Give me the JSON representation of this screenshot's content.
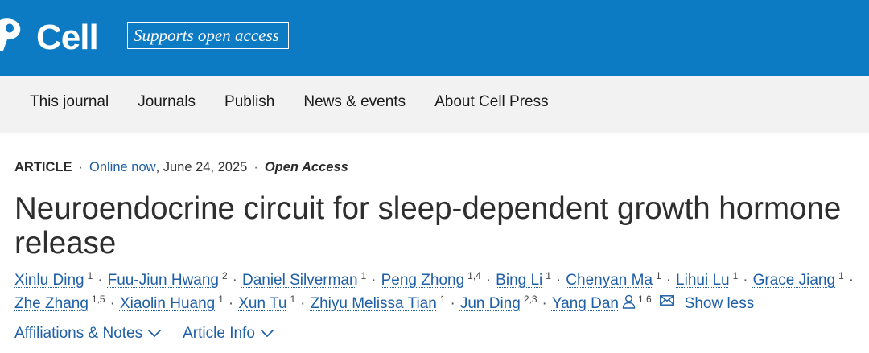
{
  "header": {
    "brand": "Cell",
    "tagline": "Supports open access",
    "logo_icon": "cell-press-logo-icon",
    "background_color": "#0d7bc4",
    "text_color": "#ffffff"
  },
  "nav": {
    "background_color": "#f2f2f2",
    "items": [
      {
        "label": "This journal"
      },
      {
        "label": "Journals"
      },
      {
        "label": "Publish"
      },
      {
        "label": "News & events"
      },
      {
        "label": "About Cell Press"
      }
    ]
  },
  "article": {
    "type_label": "ARTICLE",
    "separator": "·",
    "status": "Online now",
    "date_prefix": ",",
    "date": "June 24, 2025",
    "access": "Open Access",
    "title": "Neuroendocrine circuit for sleep-dependent growth hormone release",
    "link_color": "#1f5fa6",
    "authors": [
      {
        "name": "Xinlu Ding",
        "affiliations": "1"
      },
      {
        "name": "Fuu-Jiun Hwang",
        "affiliations": "2"
      },
      {
        "name": "Daniel Silverman",
        "affiliations": "1"
      },
      {
        "name": "Peng Zhong",
        "affiliations": "1,4"
      },
      {
        "name": "Bing Li",
        "affiliations": "1"
      },
      {
        "name": "Chenyan Ma",
        "affiliations": "1"
      },
      {
        "name": "Lihui Lu",
        "affiliations": "1"
      },
      {
        "name": "Grace Jiang",
        "affiliations": "1"
      },
      {
        "name": "Zhe Zhang",
        "affiliations": "1,5"
      },
      {
        "name": "Xiaolin Huang",
        "affiliations": "1"
      },
      {
        "name": "Xun Tu",
        "affiliations": "1"
      },
      {
        "name": "Zhiyu Melissa Tian",
        "affiliations": "1"
      },
      {
        "name": "Jun Ding",
        "affiliations": "2,3"
      },
      {
        "name": "Yang Dan",
        "affiliations": "1,6",
        "corresponding": true
      }
    ],
    "corresponding_icon": "person-icon",
    "email_icon": "envelope-icon",
    "show_less": "Show less",
    "expanders": [
      {
        "label": "Affiliations & Notes",
        "icon": "chevron-down-icon"
      },
      {
        "label": "Article Info",
        "icon": "chevron-down-icon"
      }
    ]
  }
}
